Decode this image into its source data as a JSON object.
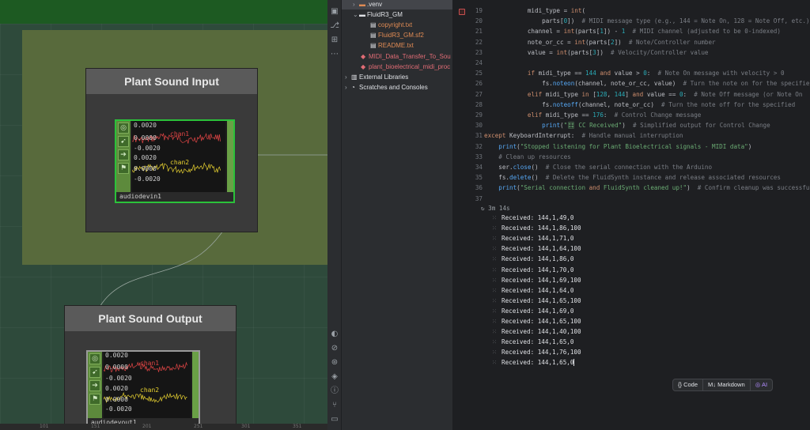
{
  "node_editor": {
    "input_comp": {
      "title": "Plant Sound Input",
      "chop_name": "audiodevin1"
    },
    "output_comp": {
      "title": "Plant Sound Output",
      "chop_name": "audiodevout1"
    },
    "chop_labels": {
      "y_top": "0.0020",
      "y_mid": "0.0000",
      "y_bot": "-0.0020",
      "chan1": "chan1",
      "chan2": "chan2"
    },
    "ruler_ticks": [
      "101",
      "151",
      "201",
      "251",
      "301",
      "351"
    ]
  },
  "project_tree": {
    "items": [
      {
        "label": ".venv",
        "kind": "folder"
      },
      {
        "label": "FluidR3_GM",
        "kind": "folder"
      },
      {
        "label": "copyright.txt",
        "kind": "file"
      },
      {
        "label": "FluidR3_GM.sf2",
        "kind": "file"
      },
      {
        "label": "README.txt",
        "kind": "file"
      },
      {
        "label": "MIDI_Data_Transfer_To_Sou",
        "kind": "file"
      },
      {
        "label": "plant_bioelectrical_midi_proc",
        "kind": "file"
      },
      {
        "label": "External Libraries",
        "kind": "folder"
      },
      {
        "label": "Scratches and Consoles",
        "kind": "folder"
      }
    ]
  },
  "editor": {
    "lines": [
      {
        "num": "19",
        "code": "            midi_type = int("
      },
      {
        "num": "20",
        "code": "                parts[0])  # MIDI message type (e.g., 144 = Note On, 128 = Note Off, etc.)"
      },
      {
        "num": "21",
        "code": "            channel = int(parts[1]) - 1  # MIDI channel (adjusted to be 0-indexed)"
      },
      {
        "num": "22",
        "code": "            note_or_cc = int(parts[2])  # Note/Controller number"
      },
      {
        "num": "23",
        "code": "            value = int(parts[3])  # Velocity/Controller value"
      },
      {
        "num": "24",
        "code": ""
      },
      {
        "num": "25",
        "code": "            if midi_type == 144 and value > 0:  # Note On message with velocity > 0"
      },
      {
        "num": "26",
        "code": "                fs.noteon(channel, note_or_cc, value)  # Turn the note on for the specified"
      },
      {
        "num": "27",
        "code": "            elif midi_type in [128, 144] and value == 0:  # Note Off message (or Note On"
      },
      {
        "num": "28",
        "code": "                fs.noteoff(channel, note_or_cc)  # Turn the note off for the specified"
      },
      {
        "num": "29",
        "code": "            elif midi_type == 176:  # Control Change message"
      },
      {
        "num": "30",
        "code": "                print(\"🎛 CC Received\")  # Simplified output for Control Change"
      },
      {
        "num": "31",
        "code": "except KeyboardInterrupt:  # Handle manual interruption"
      },
      {
        "num": "32",
        "code": "    print(\"Stopped listening for Plant Bioelectrical signals - MIDI data\")"
      },
      {
        "num": "33",
        "code": "    # Clean up resources"
      },
      {
        "num": "34",
        "code": "    ser.close()  # Close the serial connection with the Arduino"
      },
      {
        "num": "35",
        "code": "    fs.delete()  # Delete the FluidSynth instance and release associated resources"
      },
      {
        "num": "36",
        "code": "    print(\"Serial connection and FluidSynth cleaned up!\")  # Confirm cleanup was successful"
      },
      {
        "num": "37",
        "code": ""
      }
    ],
    "exec_time": "3m 14s",
    "output": [
      "Received: 144,1,49,0",
      "Received: 144,1,86,100",
      "Received: 144,1,71,0",
      "Received: 144,1,64,100",
      "Received: 144,1,86,0",
      "Received: 144,1,70,0",
      "Received: 144,1,69,100",
      "Received: 144,1,64,0",
      "Received: 144,1,65,100",
      "Received: 144,1,69,0",
      "Received: 144,1,65,100",
      "Received: 144,1,40,100",
      "Received: 144,1,65,0",
      "Received: 144,1,76,100",
      "Received: 144,1,65,0"
    ],
    "toolbar": {
      "code": "Code",
      "markdown": "Markdown",
      "ai": "AI"
    }
  }
}
